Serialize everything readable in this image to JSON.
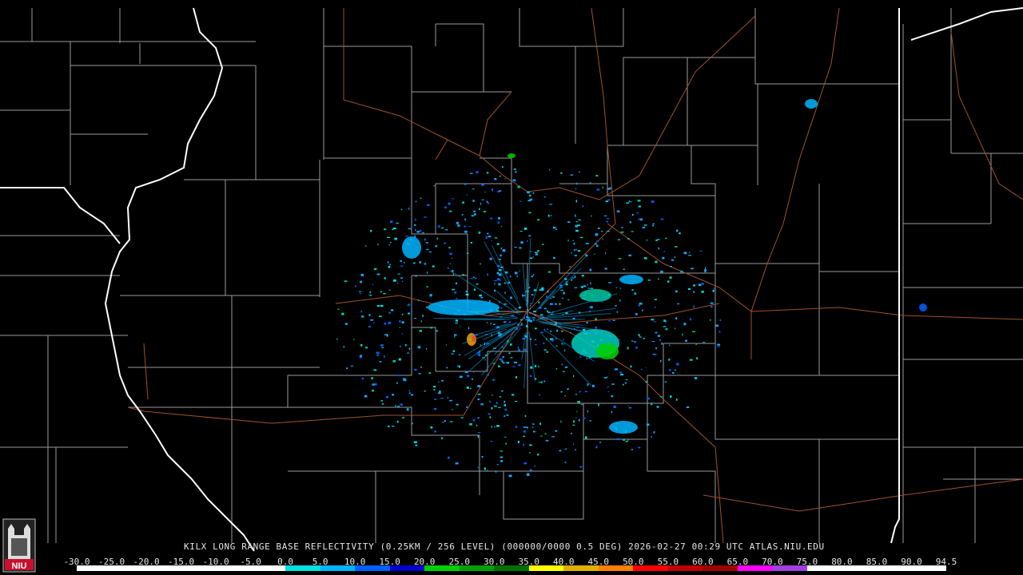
{
  "caption": "KILX LONG RANGE BASE REFLECTIVITY (0.25KM / 256 LEVEL) (000000/0000 0.5 DEG) 2026-02-27 00:29 UTC  ATLAS.NIU.EDU",
  "legend": {
    "labels": [
      "-30.0",
      "-25.0",
      "-20.0",
      "-15.0",
      "-10.0",
      "-5.0",
      "0.0",
      "5.0",
      "10.0",
      "15.0",
      "20.0",
      "25.0",
      "30.0",
      "35.0",
      "40.0",
      "45.0",
      "50.0",
      "55.0",
      "60.0",
      "65.0",
      "70.0",
      "75.0",
      "80.0",
      "85.0",
      "90.0",
      "94.5"
    ],
    "colors": [
      "#ffffff",
      "#ffffff",
      "#ffffff",
      "#ffffff",
      "#ffffff",
      "#ffffff",
      "#00e0e0",
      "#00b4ff",
      "#0060ff",
      "#0000d0",
      "#00d000",
      "#00a000",
      "#007000",
      "#ffff00",
      "#e0b000",
      "#ff8000",
      "#ff0000",
      "#c00000",
      "#a00000",
      "#ff00ff",
      "#a040e0",
      "#ffffff",
      "#ffffff",
      "#ffffff",
      "#ffffff"
    ]
  },
  "logo": {
    "text": "NIU",
    "color": "#c8102e"
  },
  "map_colors": {
    "state_border": "#ffffff",
    "county_line": "#9a9a9a",
    "road": "#a0522d",
    "background": "#000000"
  }
}
